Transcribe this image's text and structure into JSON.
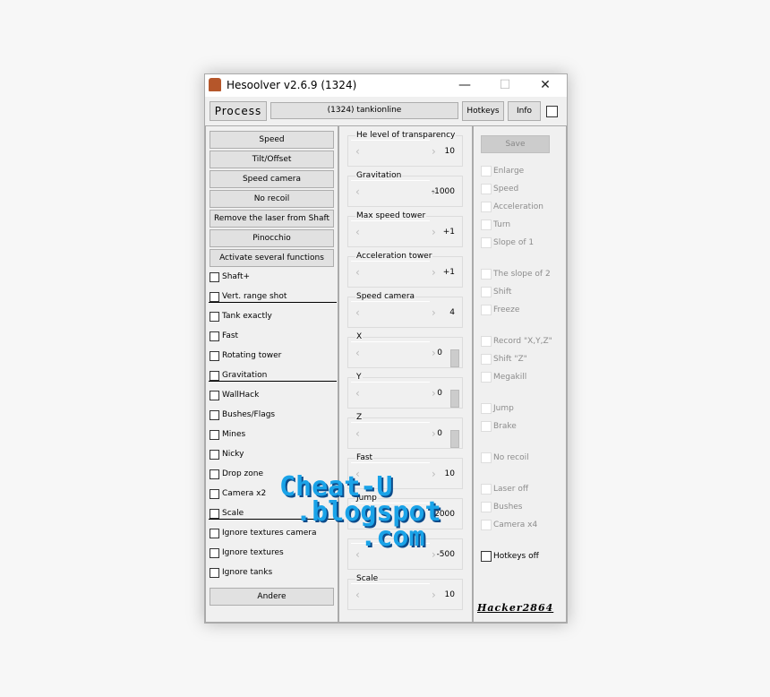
{
  "window": {
    "title": "Hesoolver v2.6.9 (1324)",
    "minimize": "—",
    "maximize": "☐",
    "close": "✕"
  },
  "toolbar": {
    "process": "Process",
    "target": "(1324) tankionline",
    "hotkeys": "Hotkeys",
    "info": "Info"
  },
  "left": {
    "buttons": [
      "Speed",
      "Tilt/Offset",
      "Speed camera",
      "No recoil",
      "Remove the laser from Shaft",
      "Pinocchio",
      "Activate several functions"
    ],
    "checkboxes": [
      "Shaft+",
      "Vert. range shot",
      "Tank exactly",
      "Fast",
      "Rotating tower",
      "Gravitation",
      "WallHack",
      "Bushes/Flags",
      "Mines",
      "Nicky",
      "Drop zone",
      "Camera x2",
      "Scale",
      "Ignore textures camera",
      "Ignore textures",
      "Ignore tanks"
    ],
    "andere": "Andere"
  },
  "middle": {
    "groups": [
      {
        "label": "He level of transparency",
        "value": "10"
      },
      {
        "label": "Gravitation",
        "value": "-1000"
      },
      {
        "label": "Max speed tower",
        "value": "+1"
      },
      {
        "label": "Acceleration tower",
        "value": "+1"
      },
      {
        "label": "Speed camera",
        "value": "4"
      },
      {
        "label": "X",
        "value": "0"
      },
      {
        "label": "Y",
        "value": "0"
      },
      {
        "label": "Z",
        "value": "0"
      },
      {
        "label": "Fast",
        "value": "10"
      },
      {
        "label": "Jump",
        "value": "2000"
      },
      {
        "label": "",
        "value": "-500"
      },
      {
        "label": "Scale",
        "value": "10"
      }
    ]
  },
  "right": {
    "save": "Save",
    "checkboxes": [
      "Enlarge",
      "Speed",
      "Acceleration",
      "Turn",
      "Slope of 1",
      "The slope of 2",
      "Shift",
      "Freeze",
      "Record \"X,Y,Z\"",
      "Shift \"Z\"",
      "Megakill",
      "Jump",
      "Brake",
      "No recoil",
      "Laser off",
      "Bushes",
      "Camera x4",
      "Hotkeys off"
    ],
    "author": "Hacker2864"
  },
  "watermark": "Cheat-U .blogspot.com"
}
